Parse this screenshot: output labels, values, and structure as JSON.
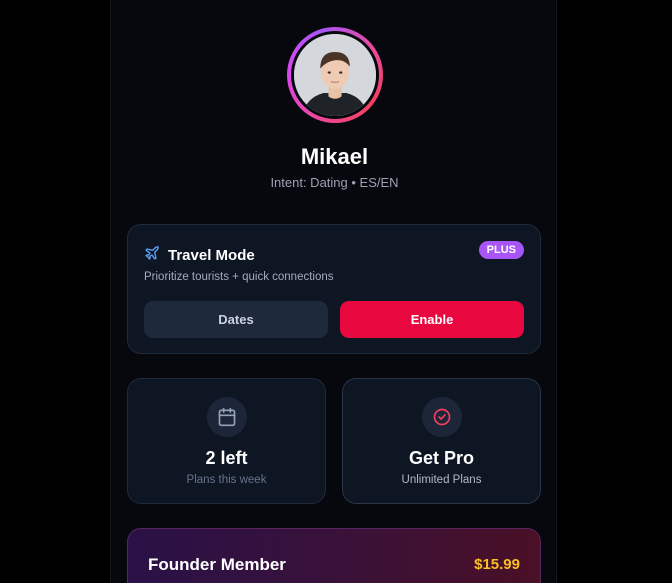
{
  "profile": {
    "name": "Mikael",
    "intent": "Intent: Dating • ES/EN"
  },
  "travel_mode": {
    "icon": "plane-icon",
    "title": "Travel Mode",
    "badge": "PLUS",
    "subtitle": "Prioritize tourists + quick connections",
    "dates_label": "Dates",
    "enable_label": "Enable"
  },
  "stats": [
    {
      "icon": "calendar-icon",
      "value": "2 left",
      "label": "Plans this week"
    },
    {
      "icon": "check-circle-icon",
      "value": "Get Pro",
      "label": "Unlimited Plans"
    }
  ],
  "founder": {
    "title": "Founder Member",
    "price": "$15.99"
  },
  "colors": {
    "accent_red": "#e9073f",
    "plus_purple": "#a855f7",
    "price_gold": "#fbbf24",
    "card_bg": "#0e1624"
  }
}
